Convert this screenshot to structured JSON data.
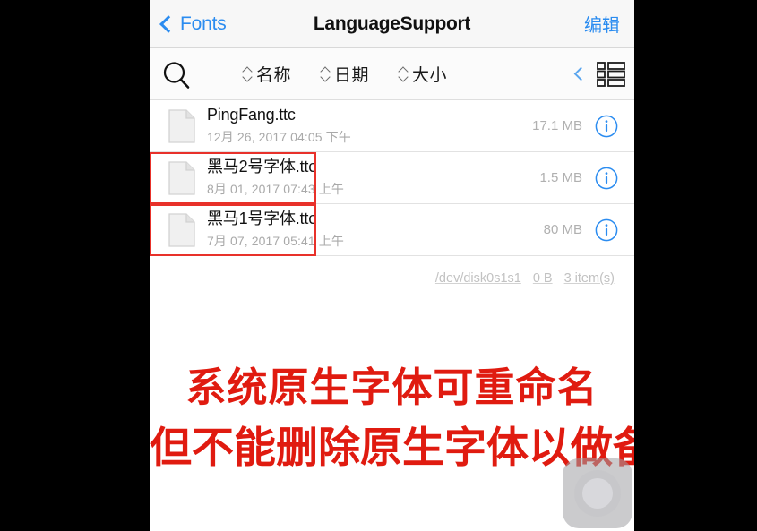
{
  "navbar": {
    "back_label": "Fonts",
    "title": "LanguageSupport",
    "edit_label": "编辑"
  },
  "toolbar": {
    "search_icon": "search-icon",
    "sort_options": [
      {
        "label": "名称",
        "icon": "sort-arrows-icon"
      },
      {
        "label": "日期",
        "icon": "sort-arrows-icon"
      },
      {
        "label": "大小",
        "icon": "sort-arrows-icon"
      }
    ],
    "collapse_icon": "chevron-left-icon",
    "view_toggle_icon": "list-view-icon"
  },
  "files": [
    {
      "name": "PingFang.ttc",
      "date": "12月 26, 2017 04:05 下午",
      "size": "17.1 MB",
      "icon": "document-icon",
      "info_icon": "info-circle-icon",
      "highlighted": false
    },
    {
      "name": "黑马2号字体.ttc",
      "date": "8月 01, 2017 07:43 上午",
      "size": "1.5 MB",
      "icon": "document-icon",
      "info_icon": "info-circle-icon",
      "highlighted": true
    },
    {
      "name": "黑马1号字体.ttc",
      "date": "7月 07, 2017 05:41 上午",
      "size": "80 MB",
      "icon": "document-icon",
      "info_icon": "info-circle-icon",
      "highlighted": true
    }
  ],
  "status": {
    "device": "/dev/disk0s1s1",
    "free_space": "0 B",
    "item_count": "3 item(s)"
  },
  "annotations": {
    "caption_1": "系统原生字体可重命名",
    "caption_2": "但不能删除原生字体以做备份",
    "highlight_color": "#e8312a",
    "caption_color": "#e01b10"
  },
  "overlay": {
    "assistive_touch_icon": "assistive-touch-button"
  },
  "theme": {
    "accent": "#2b8cf0",
    "navbar_bg": "#f7f7f7",
    "content_bg": "#ffffff",
    "letterbox": "#000000"
  }
}
